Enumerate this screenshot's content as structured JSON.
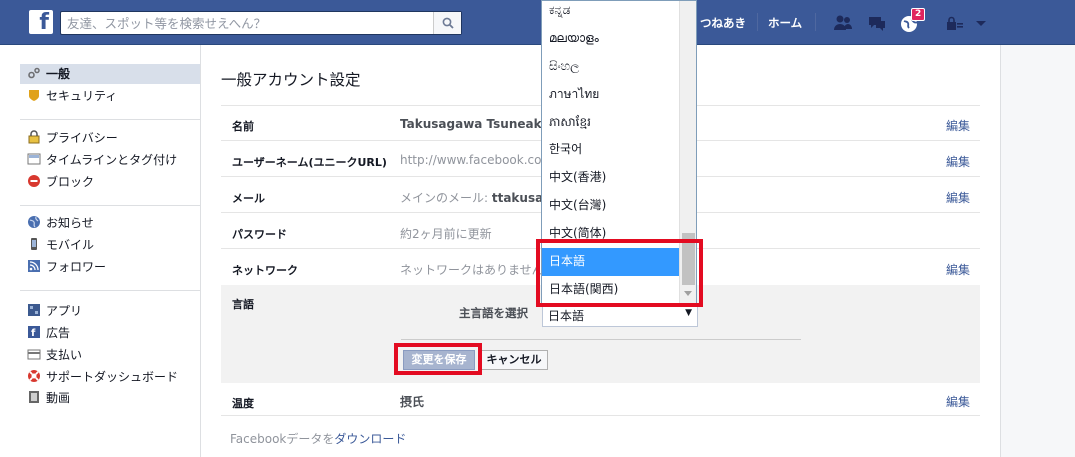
{
  "topbar": {
    "logo": "f",
    "search_placeholder": "友達、スポット等を検索せえへん？",
    "nav_friends_finder": "つねあき",
    "nav_home": "ホーム",
    "notifications_count": "2"
  },
  "sidebar": {
    "items": [
      {
        "label": "一般",
        "icon": "gear-icon"
      },
      {
        "label": "セキュリティ",
        "icon": "shield-icon"
      },
      {
        "label": "プライバシー",
        "icon": "lock-icon"
      },
      {
        "label": "タイムラインとタグ付け",
        "icon": "timeline-icon"
      },
      {
        "label": "ブロック",
        "icon": "block-icon"
      },
      {
        "label": "お知らせ",
        "icon": "globe-icon"
      },
      {
        "label": "モバイル",
        "icon": "mobile-icon"
      },
      {
        "label": "フォロワー",
        "icon": "rss-icon"
      },
      {
        "label": "アプリ",
        "icon": "apps-icon"
      },
      {
        "label": "広告",
        "icon": "ads-icon"
      },
      {
        "label": "支払い",
        "icon": "card-icon"
      },
      {
        "label": "サポートダッシュボード",
        "icon": "lifebuoy-icon"
      },
      {
        "label": "動画",
        "icon": "film-icon"
      }
    ]
  },
  "main": {
    "title": "一般アカウント設定",
    "rows": [
      {
        "label": "名前",
        "value": "Takusagawa Tsuneaki",
        "edit": "編集"
      },
      {
        "label": "ユーザーネーム(ユニークURL)",
        "value": "http://www.facebook.com/t",
        "edit": "編集"
      },
      {
        "label": "メール",
        "value_prefix": "メインのメール: ",
        "value_bold": "ttakusa@g",
        "edit": "編集"
      },
      {
        "label": "パスワード",
        "value": "約2ヶ月前に更新",
        "edit": "編集"
      },
      {
        "label": "ネットワーク",
        "value": "ネットワークはありません。",
        "edit": "編集"
      },
      {
        "label": "温度",
        "value": "摂氏",
        "edit": "編集"
      }
    ],
    "language": {
      "label": "言語",
      "primary_label": "主言語を選択",
      "selected": "日本語",
      "save": "変更を保存",
      "cancel": "キャンセル"
    },
    "download_prefix": "Facebookデータを",
    "download_link": "ダウンロード"
  },
  "dropdown": {
    "options": [
      "ಕನ್ನಡ",
      "മലയാളം",
      "සිංහල",
      "ภาษาไทย",
      "ភាសាខ្មែរ",
      "한국어",
      "中文(香港)",
      "中文(台灣)",
      "中文(简体)",
      "日本語",
      "日本語(関西)"
    ],
    "selected_index": 9
  },
  "colors": {
    "brand": "#3b5998",
    "highlight": "#e30b21",
    "selection": "#3399ff"
  }
}
